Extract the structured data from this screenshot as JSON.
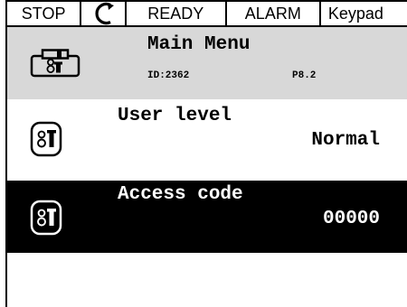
{
  "status_bar": {
    "stop": "STOP",
    "rotation_icon": "counterclockwise-arrow-icon",
    "ready": "READY",
    "alarm": "ALARM",
    "keypad": "Keypad"
  },
  "header": {
    "title": "Main Menu",
    "id": "ID:2362",
    "param": "P8.2",
    "icon": "drive-icon"
  },
  "rows": [
    {
      "label": "User level",
      "value": "Normal",
      "icon": "drive-icon",
      "selected": false
    },
    {
      "label": "Access code",
      "value": "00000",
      "icon": "drive-icon",
      "selected": true
    }
  ],
  "colors": {
    "header_bg": "#d8d8d8",
    "selected_bg": "#000000",
    "selected_fg": "#ffffff",
    "border": "#000000"
  }
}
